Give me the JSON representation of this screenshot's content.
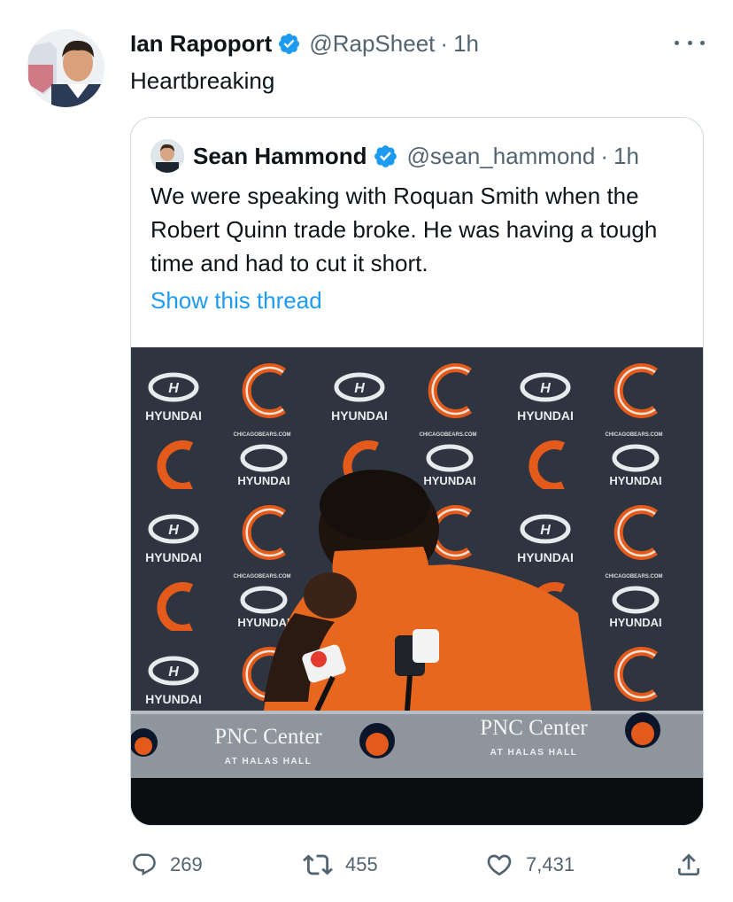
{
  "tweet": {
    "author_name": "Ian Rapoport",
    "author_handle": "@RapSheet",
    "separator": "·",
    "time": "1h",
    "text": "Heartbreaking"
  },
  "quoted_tweet": {
    "author_name": "Sean Hammond",
    "author_handle": "@sean_hammond",
    "separator": "·",
    "time": "1h",
    "text": "We were speaking with Roquan Smith when the Robert Quinn trade broke. He was having a tough time and had to cut it short.",
    "show_thread_label": "Show this thread",
    "media": {
      "backdrop_brand": "HYUNDAI",
      "backdrop_site": "CHICAGOBEARS.COM",
      "podium_brand": "PNC Center",
      "podium_sub": "AT HALAS HALL",
      "podium_brand_2": "PNC Center",
      "podium_sub_2": "AT HALAS HALL"
    }
  },
  "actions": {
    "replies": "269",
    "retweets": "455",
    "likes": "7,431"
  },
  "colors": {
    "text": "#0f1419",
    "secondary": "#536471",
    "accent": "#1d9bf0",
    "border": "#cfd9de",
    "bears_orange": "#e35a1b",
    "bears_navy": "#0b162a"
  },
  "icons": [
    "more-icon",
    "verified-icon",
    "reply-icon",
    "retweet-icon",
    "like-icon",
    "share-icon"
  ]
}
